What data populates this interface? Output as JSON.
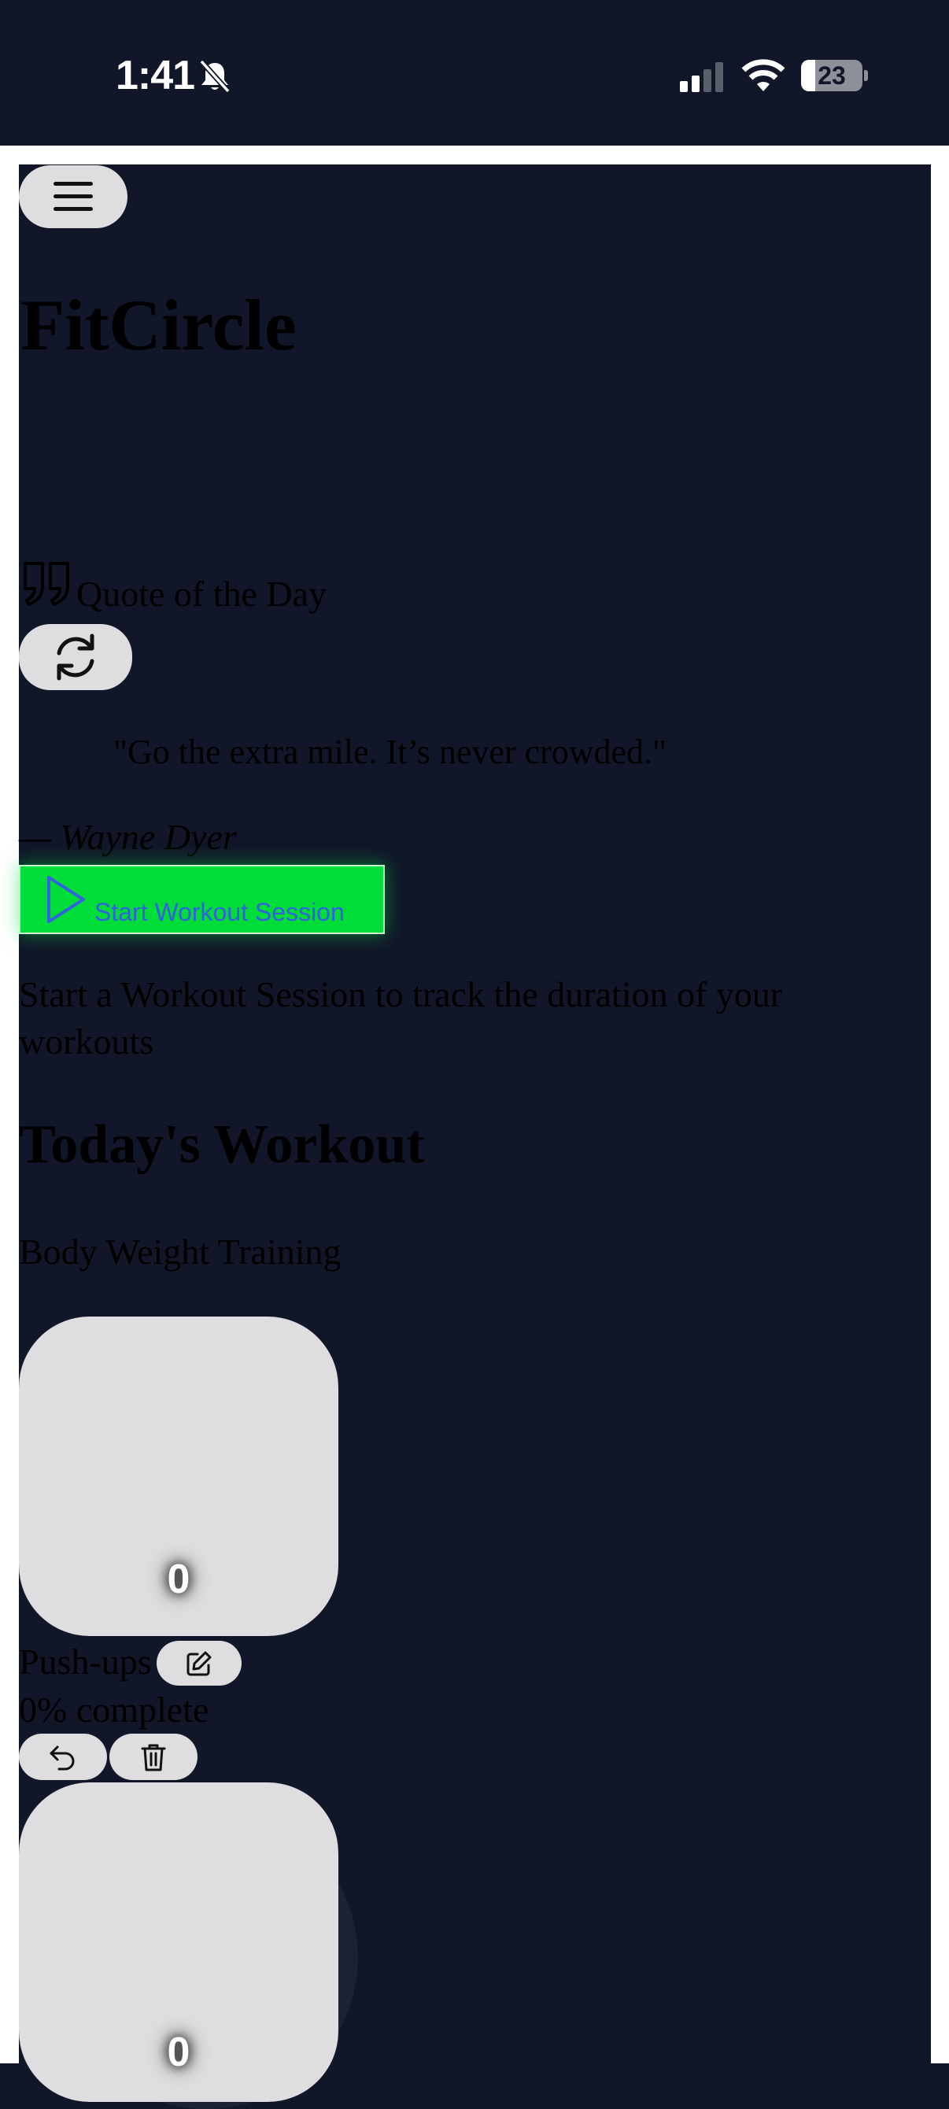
{
  "status_bar": {
    "time": "1:41",
    "battery": "23",
    "battery_fraction": 0.23,
    "icons": [
      "bell-slash-icon",
      "cellular-signal-icon",
      "wifi-icon",
      "battery-icon"
    ]
  },
  "colors": {
    "background": "#111729",
    "surface": "#dedee0",
    "accent_green": "#00dd38",
    "accent_blue": "#3361e0"
  },
  "header": {
    "menu_icon": "hamburger-menu-icon",
    "app_title": "FitCircle"
  },
  "quote": {
    "icon": "quote-icon",
    "label": "Quote of the Day",
    "refresh_icon": "refresh-icon",
    "text": "\"Go the extra mile. It’s never crowded.\"",
    "author": "— Wayne Dyer"
  },
  "session": {
    "play_icon": "play-icon",
    "button_label": "Start Workout Session",
    "hint": "Start a Workout Session to track the duration of your workouts"
  },
  "workout": {
    "section_title": "Today's Workout",
    "name": "Body Weight Training",
    "exercises": [
      {
        "count": "0",
        "name": "Push-ups",
        "edit_icon": "edit-icon",
        "progress_text": "0% complete",
        "progress": 0,
        "undo_icon": "undo-icon",
        "delete_icon": "trash-icon"
      },
      {
        "count": "0"
      }
    ]
  }
}
